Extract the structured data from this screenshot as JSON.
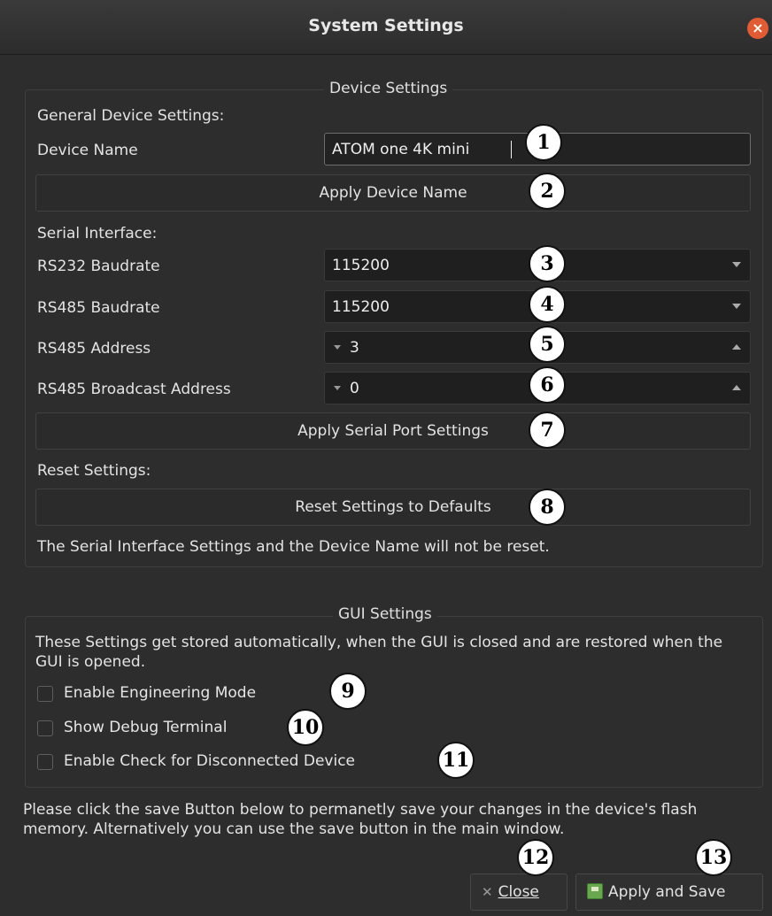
{
  "window": {
    "title": "System Settings"
  },
  "device_settings": {
    "group_title": "Device Settings",
    "general_label": "General Device Settings:",
    "device_name_label": "Device Name",
    "device_name_value": "ATOM one 4K mini",
    "apply_device_name_label": "Apply Device Name",
    "serial_label": "Serial Interface:",
    "rs232_baud_label": "RS232 Baudrate",
    "rs232_baud_value": "115200",
    "rs485_baud_label": "RS485 Baudrate",
    "rs485_baud_value": "115200",
    "rs485_addr_label": "RS485 Address",
    "rs485_addr_value": "3",
    "rs485_bcast_label": "RS485 Broadcast Address",
    "rs485_bcast_value": "0",
    "apply_serial_label": "Apply Serial Port Settings",
    "reset_label": "Reset Settings:",
    "reset_button_label": "Reset Settings to Defaults",
    "reset_note": "The Serial Interface Settings and the Device Name will not be reset."
  },
  "gui_settings": {
    "group_title": "GUI Settings",
    "note": "These Settings get stored automatically, when the GUI is closed and are restored when the GUI is opened.",
    "checkboxes": [
      {
        "label": "Enable Engineering Mode",
        "checked": false
      },
      {
        "label": "Show Debug Terminal",
        "checked": false
      },
      {
        "label": "Enable Check for Disconnected Device",
        "checked": false
      }
    ]
  },
  "footer": {
    "note": "Please click the save Button below to permanetly save your changes in the device's flash memory. Alternatively you can use the save button in the main window.",
    "close_label": "Close",
    "apply_save_label": "Apply and Save"
  },
  "badges": [
    "1",
    "2",
    "3",
    "4",
    "5",
    "6",
    "7",
    "8",
    "9",
    "10",
    "11",
    "12",
    "13"
  ]
}
